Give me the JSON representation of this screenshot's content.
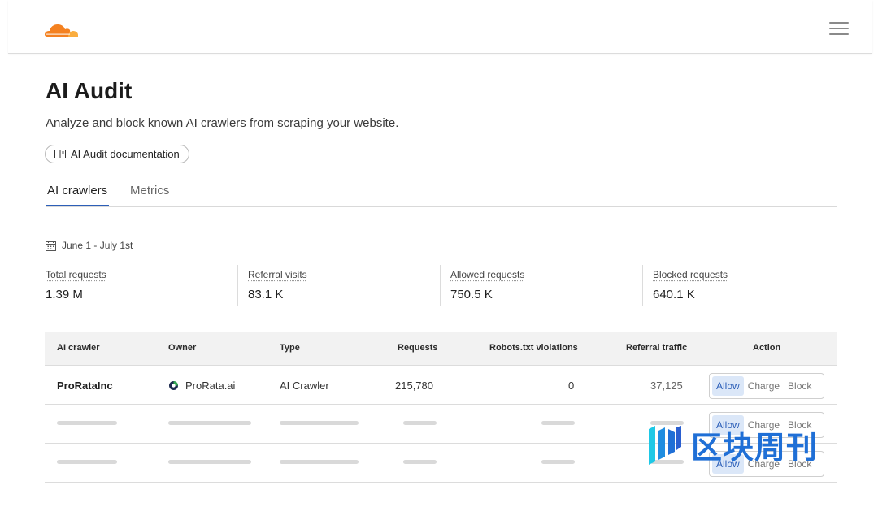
{
  "app": {
    "logo_icon": "cloud-icon",
    "brand_color": "#f48120",
    "accent": "#2c5fb8"
  },
  "header": {
    "menu_icon": "hamburger-menu-icon"
  },
  "page": {
    "title": "AI Audit",
    "subtitle": "Analyze and block known AI crawlers from scraping your website.",
    "doc_button": "AI Audit documentation"
  },
  "tabs": [
    {
      "label": "AI crawlers",
      "active": true
    },
    {
      "label": "Metrics",
      "active": false
    }
  ],
  "date_range": "June 1 - July 1st",
  "stats": [
    {
      "label": "Total requests",
      "value": "1.39 M"
    },
    {
      "label": "Referral visits",
      "value": "83.1 K"
    },
    {
      "label": "Allowed requests",
      "value": "750.5 K"
    },
    {
      "label": "Blocked requests",
      "value": "640.1 K"
    }
  ],
  "table": {
    "columns": [
      "AI crawler",
      "Owner",
      "Type",
      "Requests",
      "Robots.txt violations",
      "Referral traffic",
      "Action"
    ],
    "rows": [
      {
        "crawler": "ProRataInc",
        "owner": "ProRata.ai",
        "type": "AI Crawler",
        "requests": "215,780",
        "violations": "0",
        "referral": "37,125"
      }
    ],
    "actions": [
      "Allow",
      "Charge",
      "Block"
    ],
    "selected_action": "Allow"
  },
  "watermark": {
    "text": "区块周刊"
  }
}
